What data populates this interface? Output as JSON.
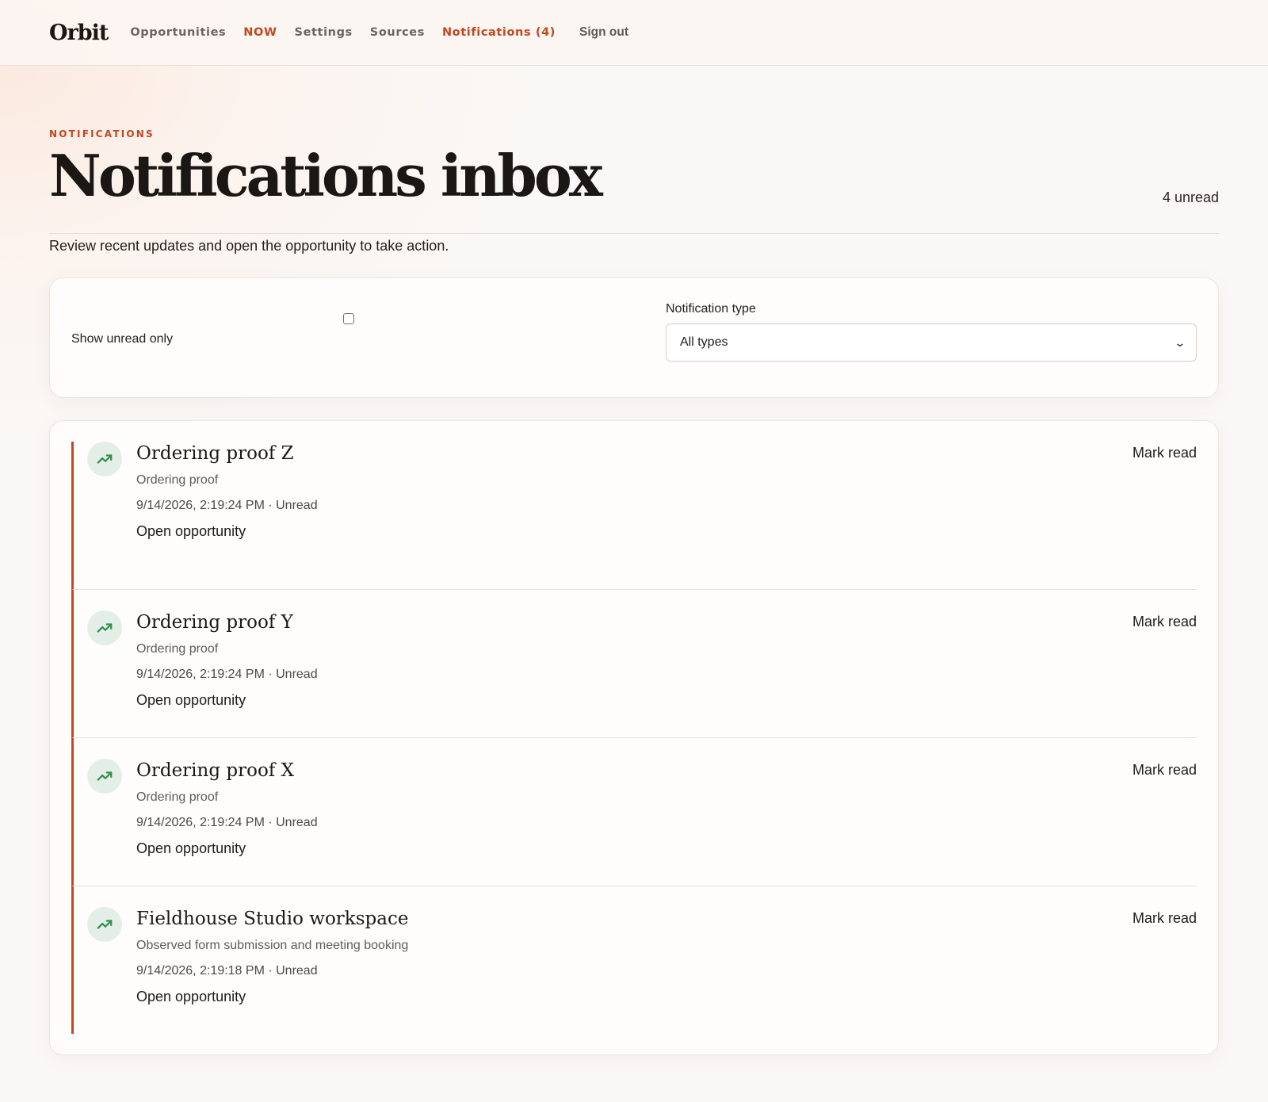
{
  "app": {
    "logo": "Orbit",
    "nav": [
      {
        "label": "Opportunities"
      },
      {
        "label": "NOW"
      },
      {
        "label": "Settings"
      },
      {
        "label": "Sources"
      },
      {
        "label": "Notifications (4)"
      }
    ],
    "signout": "Sign out",
    "accent_color": "#c4461f"
  },
  "page": {
    "eyebrow": "NOTIFICATIONS",
    "title": "Notifications inbox",
    "unread_count": "4 unread",
    "subtitle": "Review recent updates and open the opportunity to take action."
  },
  "filters": {
    "unread_only_label": "Show unread only",
    "unread_only_checked": false,
    "type_label": "Notification type",
    "type_selected": "All types"
  },
  "notifications": [
    {
      "icon": "trending-up-icon",
      "title": "Ordering proof Z",
      "description": "Ordering proof",
      "meta": "9/14/2026, 2:19:24 PM · Unread",
      "link": "Open opportunity",
      "action": "Mark read"
    },
    {
      "icon": "trending-up-icon",
      "title": "Ordering proof Y",
      "description": "Ordering proof",
      "meta": "9/14/2026, 2:19:24 PM · Unread",
      "link": "Open opportunity",
      "action": "Mark read"
    },
    {
      "icon": "trending-up-icon",
      "title": "Ordering proof X",
      "description": "Ordering proof",
      "meta": "9/14/2026, 2:19:24 PM · Unread",
      "link": "Open opportunity",
      "action": "Mark read"
    },
    {
      "icon": "trending-up-icon",
      "title": "Fieldhouse Studio workspace",
      "description": "Observed form submission and meeting booking",
      "meta": "9/14/2026, 2:19:18 PM · Unread",
      "link": "Open opportunity",
      "action": "Mark read"
    }
  ]
}
